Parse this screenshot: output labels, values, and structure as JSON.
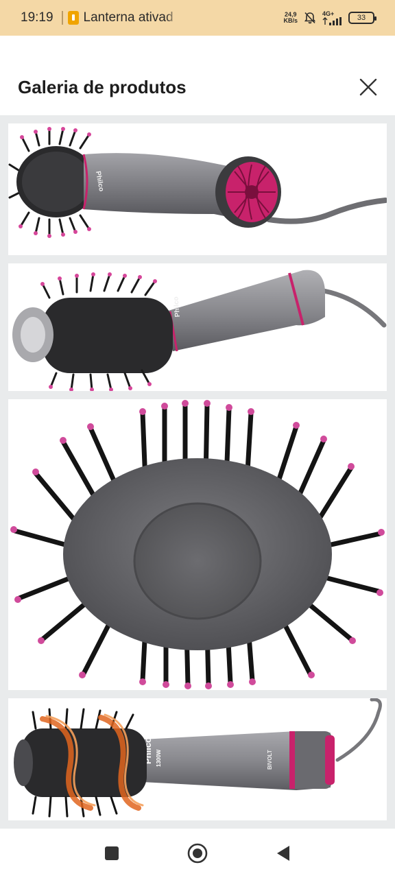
{
  "status_bar": {
    "time": "19:19",
    "notification": "Lanterna ativad",
    "net_speed_value": "24,9",
    "net_speed_unit": "KB/s",
    "network_type": "4G+",
    "battery": "33"
  },
  "header": {
    "title": "Galeria de produtos"
  },
  "gallery": {
    "images": [
      {
        "brand_text": "Philco"
      },
      {
        "brand_text": "Philco"
      },
      {
        "brand_text": ""
      },
      {
        "brand_text": "Philco",
        "model_text": "1300W",
        "voltage_text": "BIVOLT"
      }
    ]
  },
  "colors": {
    "status_bar_bg": "#f4d8a6",
    "accent_pink": "#c8226b",
    "device_gray": "#8a8a8e",
    "bristle_black": "#1a1a1a"
  }
}
